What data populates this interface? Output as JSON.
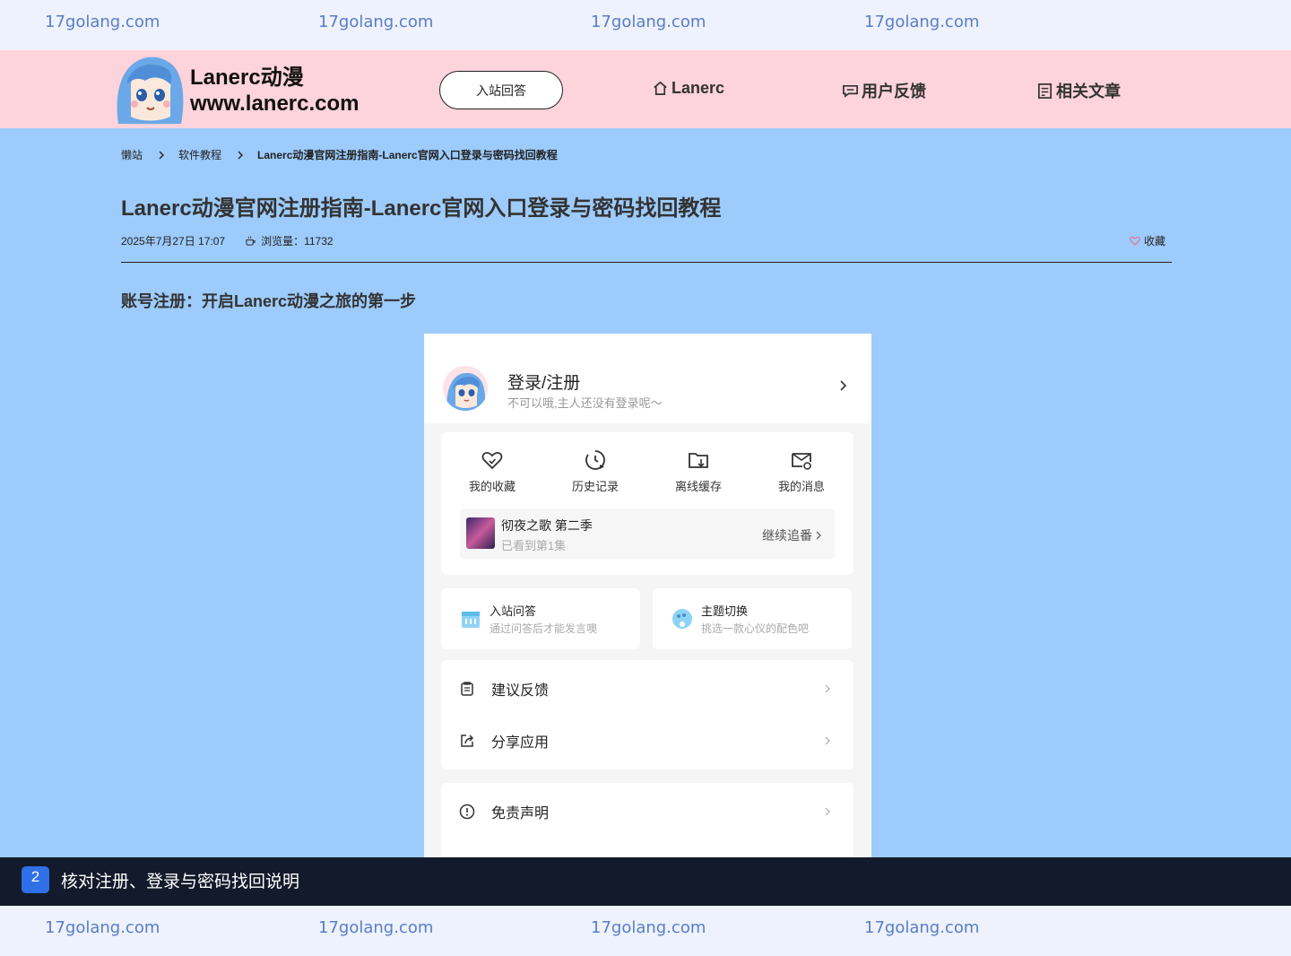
{
  "watermark": {
    "text": "17golang.com"
  },
  "header": {
    "logo_name": "Lanerc动漫",
    "logo_url": "www.lanerc.com",
    "qa_button": "入站回答",
    "nav": [
      {
        "label": "Lanerc",
        "icon": "home-icon"
      },
      {
        "label": "用户反馈",
        "icon": "chat-icon"
      },
      {
        "label": "相关文章",
        "icon": "document-icon"
      }
    ]
  },
  "breadcrumb": {
    "items": [
      "懒站",
      "软件教程",
      "Lanerc动漫官网注册指南-Lanerc官网入口登录与密码找回教程"
    ]
  },
  "article": {
    "title": "Lanerc动漫官网注册指南-Lanerc官网入口登录与密码找回教程",
    "date": "2025年7月27日 17:07",
    "views": "浏览量：11732",
    "favorite": "收藏",
    "section_heading": "账号注册：开启Lanerc动漫之旅的第一步"
  },
  "phone": {
    "login_title": "登录/注册",
    "login_sub": "不可以哦,主人还没有登录呢～",
    "quick": [
      {
        "label": "我的收藏",
        "icon": "heart-icon"
      },
      {
        "label": "历史记录",
        "icon": "history-icon"
      },
      {
        "label": "离线缓存",
        "icon": "folder-download-icon"
      },
      {
        "label": "我的消息",
        "icon": "mail-icon"
      }
    ],
    "continue": {
      "title": "彻夜之歌 第二季",
      "progress": "已看到第1集",
      "button": "继续追番"
    },
    "cards": [
      {
        "title": "入站问答",
        "sub": "通过问答后才能发言噢",
        "icon": "calendar-icon"
      },
      {
        "title": "主题切换",
        "sub": "挑选一款心仪的配色吧",
        "icon": "palette-icon"
      }
    ],
    "menu": [
      {
        "label": "建议反馈",
        "icon": "clipboard-icon"
      },
      {
        "label": "分享应用",
        "icon": "share-icon"
      },
      {
        "label": "免责声明",
        "icon": "info-icon"
      }
    ]
  },
  "banner": {
    "number": "2",
    "text": "核对注册、登录与密码找回说明"
  },
  "colors": {
    "page_bg": "#9dcbfb",
    "header_bg": "#fdd3dc",
    "watermark_bg": "#edf2fc",
    "banner_bg": "#131a2b",
    "accent": "#2f6fe8"
  }
}
